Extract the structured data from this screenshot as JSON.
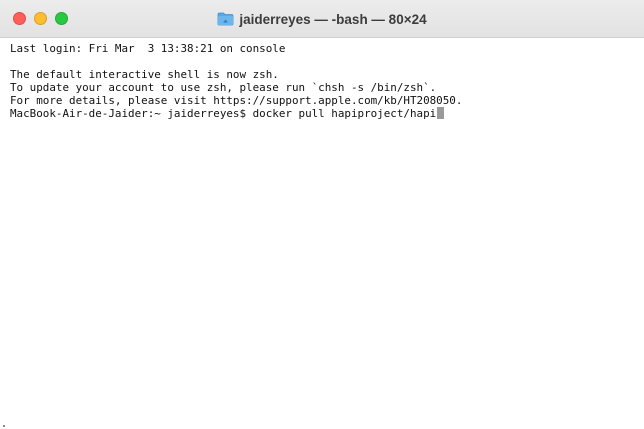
{
  "window": {
    "title": "jaiderreyes — -bash — 80×24",
    "folder_icon": "folder-icon",
    "buttons": {
      "close_color": "#ff5f57",
      "minimize_color": "#febc2e",
      "zoom_color": "#28c840"
    }
  },
  "terminal": {
    "lines": [
      "Last login: Fri Mar  3 13:38:21 on console",
      "",
      "The default interactive shell is now zsh.",
      "To update your account to use zsh, please run `chsh -s /bin/zsh`.",
      "For more details, please visit https://support.apple.com/kb/HT208050."
    ],
    "prompt": "MacBook-Air-de-Jaider:~ jaiderreyes$ ",
    "command": "docker pull hapiproject/hapi",
    "cursor_color": "#9a9a9a"
  }
}
